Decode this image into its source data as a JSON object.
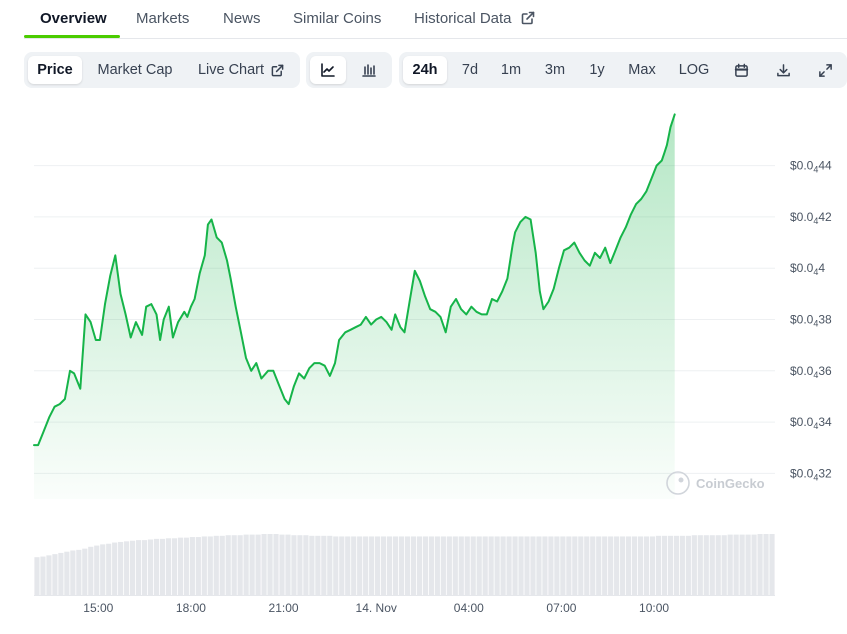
{
  "tabs": {
    "overview": "Overview",
    "markets": "Markets",
    "news": "News",
    "similar_coins": "Similar Coins",
    "historical_data": "Historical Data"
  },
  "controls": {
    "price": "Price",
    "market_cap": "Market Cap",
    "live_chart": "Live Chart",
    "range_24h": "24h",
    "range_7d": "7d",
    "range_1m": "1m",
    "range_3m": "3m",
    "range_1y": "1y",
    "range_max": "Max",
    "log": "LOG"
  },
  "icons": {
    "line_chart": "line-chart-icon",
    "candlestick": "candlestick-icon",
    "calendar": "calendar-icon",
    "download": "download-icon",
    "fullscreen": "fullscreen-icon",
    "external_link": "external-link-icon"
  },
  "colors": {
    "line": "#16b449",
    "accent": "#4bcc00",
    "volume": "#e5e7eb"
  },
  "watermark": "CoinGecko",
  "chart_data": {
    "type": "area",
    "ylabel_prefix": "$0.0",
    "ylabel_subscript": "4",
    "y_ticks": [
      {
        "value": 4.4e-06,
        "label_main": "44"
      },
      {
        "value": 4.2e-06,
        "label_main": "42"
      },
      {
        "value": 4e-06,
        "label_main": "4"
      },
      {
        "value": 3.8e-06,
        "label_main": "38"
      },
      {
        "value": 3.6e-06,
        "label_main": "36"
      },
      {
        "value": 3.4e-06,
        "label_main": "34"
      },
      {
        "value": 3.2e-06,
        "label_main": "32"
      }
    ],
    "ylim": [
      3.1e-06,
      4.5e-06
    ],
    "xlim": [
      0,
      1440
    ],
    "x_ticks": [
      {
        "t": 125,
        "label": "15:00"
      },
      {
        "t": 305,
        "label": "18:00"
      },
      {
        "t": 485,
        "label": "21:00"
      },
      {
        "t": 665,
        "label": "14. Nov"
      },
      {
        "t": 845,
        "label": "04:00"
      },
      {
        "t": 1025,
        "label": "07:00"
      },
      {
        "t": 1205,
        "label": "10:00"
      }
    ],
    "series": [
      {
        "x": [
          0,
          8,
          18,
          30,
          40,
          50,
          60,
          70,
          78,
          90,
          100,
          110,
          120,
          128,
          138,
          148,
          158,
          168,
          178,
          188,
          198,
          210,
          218,
          228,
          238,
          245,
          252,
          262,
          270,
          280,
          292,
          298,
          305,
          312,
          322,
          332,
          338,
          345,
          355,
          365,
          375,
          382,
          392,
          402,
          412,
          422,
          432,
          442,
          455,
          465,
          475,
          487,
          495,
          505,
          515,
          525,
          535,
          545,
          555,
          565,
          575,
          585,
          593,
          605,
          615,
          625,
          635,
          645,
          655,
          665,
          675,
          685,
          695,
          702,
          712,
          720,
          730,
          740,
          750,
          760,
          770,
          780,
          790,
          800,
          810,
          820,
          830,
          840,
          850,
          860,
          870,
          880,
          890,
          900,
          910,
          920,
          930,
          935,
          945,
          955,
          965,
          975,
          983,
          990,
          1000,
          1010,
          1020,
          1030,
          1040,
          1050,
          1060,
          1070,
          1080,
          1090,
          1100,
          1110,
          1120,
          1130,
          1140,
          1150,
          1160,
          1170,
          1180,
          1190,
          1200,
          1210,
          1220,
          1225,
          1230,
          1237,
          1245
        ],
        "y": [
          3.31,
          3.31,
          3.36,
          3.42,
          3.46,
          3.47,
          3.49,
          3.6,
          3.59,
          3.53,
          3.82,
          3.79,
          3.72,
          3.72,
          3.86,
          3.97,
          4.05,
          3.9,
          3.82,
          3.73,
          3.79,
          3.74,
          3.85,
          3.86,
          3.82,
          3.72,
          3.8,
          3.85,
          3.73,
          3.79,
          3.83,
          3.81,
          3.85,
          3.88,
          3.98,
          4.05,
          4.17,
          4.19,
          4.12,
          4.1,
          4.03,
          3.96,
          3.85,
          3.75,
          3.65,
          3.6,
          3.63,
          3.57,
          3.6,
          3.6,
          3.55,
          3.49,
          3.47,
          3.54,
          3.59,
          3.57,
          3.61,
          3.63,
          3.63,
          3.62,
          3.58,
          3.63,
          3.72,
          3.75,
          3.76,
          3.77,
          3.78,
          3.81,
          3.78,
          3.8,
          3.81,
          3.79,
          3.76,
          3.82,
          3.77,
          3.75,
          3.87,
          3.99,
          3.95,
          3.89,
          3.84,
          3.83,
          3.81,
          3.75,
          3.85,
          3.88,
          3.84,
          3.82,
          3.85,
          3.83,
          3.82,
          3.82,
          3.88,
          3.87,
          3.91,
          3.96,
          4.09,
          4.14,
          4.18,
          4.2,
          4.19,
          4.06,
          3.91,
          3.84,
          3.87,
          3.92,
          4.0,
          4.07,
          4.08,
          4.1,
          4.06,
          4.03,
          4.01,
          4.06,
          4.04,
          4.08,
          4.02,
          4.07,
          4.12,
          4.16,
          4.21,
          4.25,
          4.27,
          4.3,
          4.35,
          4.4,
          4.42,
          4.45,
          4.48,
          4.55,
          4.6
        ]
      }
    ],
    "volume": {
      "bars": 124,
      "relative_levels": [
        0.62,
        0.63,
        0.65,
        0.67,
        0.69,
        0.71,
        0.73,
        0.74,
        0.76,
        0.79,
        0.81,
        0.83,
        0.84,
        0.86,
        0.87,
        0.88,
        0.89,
        0.9,
        0.9,
        0.91,
        0.92,
        0.92,
        0.93,
        0.93,
        0.94,
        0.94,
        0.95,
        0.95,
        0.96,
        0.96,
        0.97,
        0.97,
        0.98,
        0.98,
        0.98,
        0.99,
        0.99,
        0.99,
        1.0,
        1.0,
        1.0,
        0.99,
        0.99,
        0.98,
        0.98,
        0.98,
        0.97,
        0.97,
        0.97,
        0.97,
        0.96,
        0.96,
        0.96,
        0.96,
        0.96,
        0.96,
        0.96,
        0.96,
        0.96,
        0.96,
        0.96,
        0.96,
        0.96,
        0.96,
        0.96,
        0.96,
        0.96,
        0.96,
        0.96,
        0.96,
        0.96,
        0.96,
        0.96,
        0.96,
        0.96,
        0.96,
        0.96,
        0.96,
        0.96,
        0.96,
        0.96,
        0.96,
        0.96,
        0.96,
        0.96,
        0.96,
        0.96,
        0.96,
        0.96,
        0.96,
        0.96,
        0.96,
        0.96,
        0.96,
        0.96,
        0.96,
        0.96,
        0.96,
        0.96,
        0.96,
        0.96,
        0.96,
        0.96,
        0.96,
        0.97,
        0.97,
        0.97,
        0.97,
        0.97,
        0.97,
        0.98,
        0.98,
        0.98,
        0.98,
        0.98,
        0.98,
        0.99,
        0.99,
        0.99,
        0.99,
        0.99,
        1.0,
        1.0,
        1.0
      ]
    }
  }
}
